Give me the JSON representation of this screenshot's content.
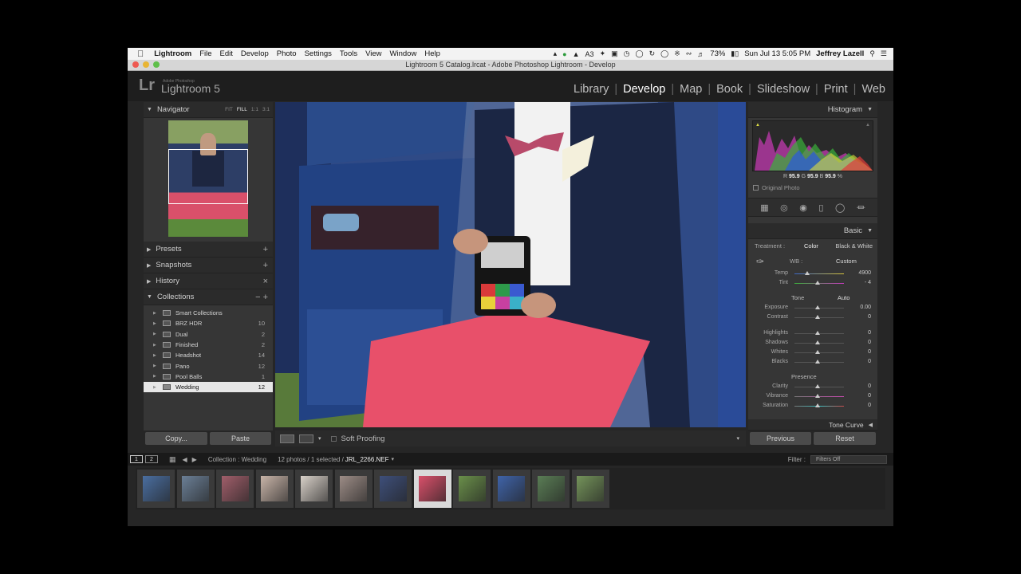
{
  "menubar": {
    "apple": "",
    "app": "Lightroom",
    "items": [
      "File",
      "Edit",
      "Develop",
      "Photo",
      "Settings",
      "Tools",
      "View",
      "Window",
      "Help"
    ],
    "battery": "73%",
    "datetime": "Sun Jul 13  5:05 PM",
    "user": "Jeffrey Lazell",
    "status_n": "3"
  },
  "window": {
    "title": "Lightroom 5 Catalog.lrcat - Adobe Photoshop Lightroom - Develop"
  },
  "identity": {
    "lr": "Lr",
    "adobe": "Adobe Photoshop",
    "product": "Lightroom 5"
  },
  "modules": [
    "Library",
    "Develop",
    "Map",
    "Book",
    "Slideshow",
    "Print",
    "Web"
  ],
  "left": {
    "navigator": {
      "title": "Navigator",
      "zoom": [
        "FIT",
        "FILL",
        "1:1",
        "3:1"
      ]
    },
    "presets": "Presets",
    "snapshots": "Snapshots",
    "history": "History",
    "collections": {
      "title": "Collections",
      "items": [
        {
          "name": "Smart Collections",
          "count": ""
        },
        {
          "name": "BRZ HDR",
          "count": "10"
        },
        {
          "name": "Dual",
          "count": "2"
        },
        {
          "name": "Finished",
          "count": "2"
        },
        {
          "name": "Headshot",
          "count": "14"
        },
        {
          "name": "Pano",
          "count": "12"
        },
        {
          "name": "Pool Balls",
          "count": "1"
        },
        {
          "name": "Wedding",
          "count": "12"
        }
      ]
    },
    "copy": "Copy...",
    "paste": "Paste"
  },
  "right": {
    "histogram": "Histogram",
    "rgb": {
      "r_label": "R",
      "r": "95.9",
      "g_label": "G",
      "g": "95.9",
      "b_label": "B",
      "b": "95.9",
      "unit": "%"
    },
    "original_photo": "Original Photo",
    "basic": "Basic",
    "treatment": {
      "label": "Treatment :",
      "color": "Color",
      "bw": "Black & White"
    },
    "wb": {
      "label": "WB :",
      "value": "Custom"
    },
    "temp": {
      "label": "Temp",
      "value": "4900"
    },
    "tint": {
      "label": "Tint",
      "value": "- 4"
    },
    "tone": {
      "label": "Tone",
      "auto": "Auto"
    },
    "tone_rows": [
      {
        "label": "Exposure",
        "value": "0.00"
      },
      {
        "label": "Contrast",
        "value": "0"
      }
    ],
    "tone_rows2": [
      {
        "label": "Highlights",
        "value": "0"
      },
      {
        "label": "Shadows",
        "value": "0"
      },
      {
        "label": "Whites",
        "value": "0"
      },
      {
        "label": "Blacks",
        "value": "0"
      }
    ],
    "presence": "Presence",
    "presence_rows": [
      {
        "label": "Clarity",
        "value": "0"
      },
      {
        "label": "Vibrance",
        "value": "0"
      },
      {
        "label": "Saturation",
        "value": "0"
      }
    ],
    "tone_curve": "Tone Curve",
    "previous": "Previous",
    "reset": "Reset"
  },
  "toolbar": {
    "soft_proofing": "Soft Proofing"
  },
  "filmstrip": {
    "page1": "1",
    "page2": "2",
    "source": "Collection : Wedding",
    "count": "12 photos / 1 selected /",
    "file": "JRL_2266.NEF",
    "filter_label": "Filter :",
    "filter_value": "Filters Off",
    "selected_index": 7,
    "thumb_colors": [
      "#4a6ea0",
      "#6b7f96",
      "#a05e6a",
      "#c8b4a8",
      "#d8d0c8",
      "#9c8c86",
      "#3e4f7a",
      "#d9506a",
      "#6a8f4a",
      "#3f63a8",
      "#5a7d55",
      "#74935a"
    ]
  }
}
